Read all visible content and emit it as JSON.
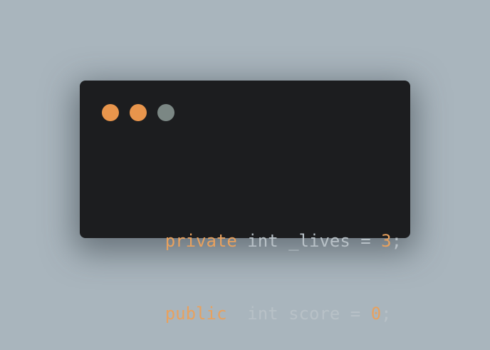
{
  "colors": {
    "background": "#a9b5bd",
    "window": "#1c1d1f",
    "keyword": "#e8a15e",
    "number": "#e8a15e",
    "text": "#b8c1c7"
  },
  "window_controls": [
    {
      "name": "close",
      "color": "#e8954c"
    },
    {
      "name": "minimize",
      "color": "#e8954c"
    },
    {
      "name": "maximize",
      "color": "#7b8784"
    }
  ],
  "code": {
    "lines": [
      {
        "tokens": [
          {
            "type": "keyword",
            "text": "private"
          },
          {
            "type": "plain",
            "text": " int _lives = "
          },
          {
            "type": "number",
            "text": "3"
          },
          {
            "type": "plain",
            "text": ";"
          }
        ]
      },
      {
        "tokens": [
          {
            "type": "keyword",
            "text": "public"
          },
          {
            "type": "plain",
            "text": "  int score = "
          },
          {
            "type": "number",
            "text": "0"
          },
          {
            "type": "plain",
            "text": ";"
          }
        ]
      }
    ]
  }
}
